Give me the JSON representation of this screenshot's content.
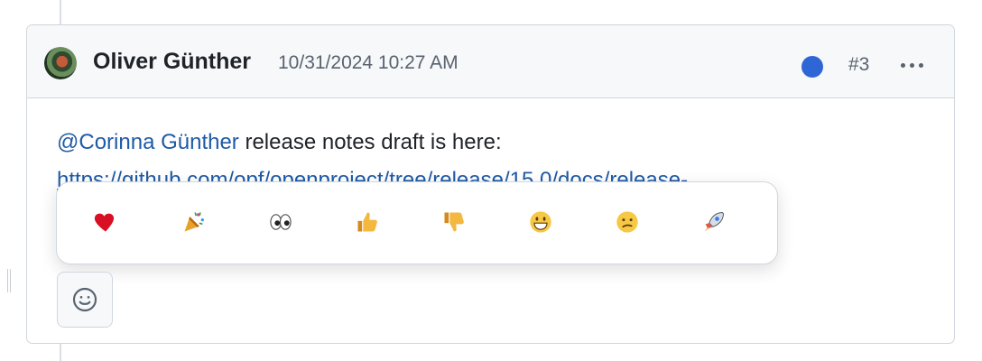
{
  "comment": {
    "author": "Oliver Günther",
    "timestamp": "10/31/2024 10:27 AM",
    "number": "#3",
    "mention": "@Corinna Günther",
    "text": " release notes draft is here:",
    "link_visible": "https://github.com/opf/openproject/tree/release/15.0/docs/release-",
    "status_color": "#2f66d5"
  },
  "reactions": [
    {
      "name": "heart",
      "icon": "red-heart-icon"
    },
    {
      "name": "party",
      "icon": "party-popper-icon"
    },
    {
      "name": "eyes",
      "icon": "eyes-icon"
    },
    {
      "name": "thumbs-up",
      "icon": "thumbs-up-icon"
    },
    {
      "name": "thumbs-down",
      "icon": "thumbs-down-icon"
    },
    {
      "name": "smile",
      "icon": "grinning-face-icon"
    },
    {
      "name": "confused",
      "icon": "confused-face-icon"
    },
    {
      "name": "rocket",
      "icon": "rocket-icon"
    }
  ],
  "toolbar": {
    "add_reaction_icon": "smiley-icon"
  }
}
